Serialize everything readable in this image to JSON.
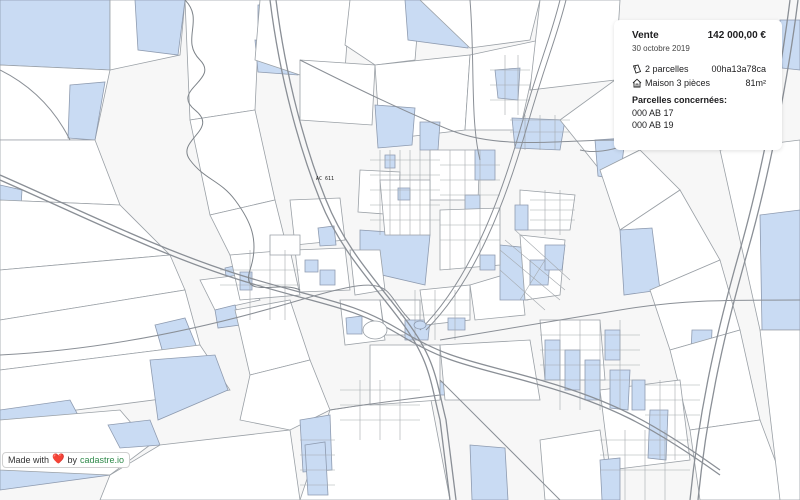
{
  "map": {
    "section_label": "AC 611",
    "colors": {
      "parcel": "#ffffff",
      "sold_parcel": "#c9dbf3",
      "background": "#f7f7f7",
      "road": "#8a8f96"
    }
  },
  "sale_card": {
    "title": "Vente",
    "price": "142 000,00 €",
    "date": "30 octobre 2019",
    "parcels_count": "2 parcelles",
    "reference": "00ha13a78ca",
    "property_type": "Maison 3 pièces",
    "surface": "81m²",
    "parcels_heading": "Parcelles concernées:",
    "parcels": [
      "000 AB 17",
      "000 AB 19"
    ],
    "icons": [
      "parcels-icon",
      "house-icon"
    ]
  },
  "credit": {
    "made_with": "Made with",
    "heart": "❤️",
    "by": "by",
    "brand": "cadastre.io",
    "heart_color": "#d93b3b",
    "brand_color": "#2f8a4a"
  }
}
